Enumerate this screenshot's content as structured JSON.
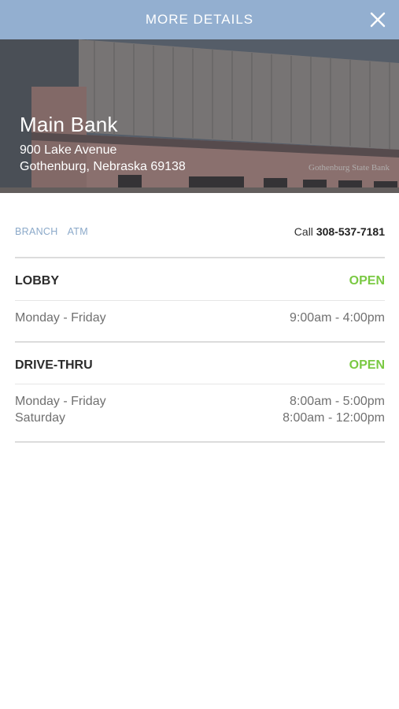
{
  "header": {
    "title": "MORE DETAILS",
    "close_icon": "close-icon"
  },
  "location": {
    "name": "Main Bank",
    "address_line1": "900 Lake Avenue",
    "address_line2": "Gothenburg, Nebraska 69138",
    "building_sign": "Gothenburg State Bank"
  },
  "tabs": [
    {
      "label": "BRANCH"
    },
    {
      "label": "ATM"
    }
  ],
  "call": {
    "prefix": "Call",
    "number": "308-537-7181"
  },
  "sections": [
    {
      "title": "LOBBY",
      "status": "OPEN",
      "hours": [
        {
          "days": "Monday - Friday",
          "time": "9:00am - 4:00pm"
        }
      ]
    },
    {
      "title": "DRIVE-THRU",
      "status": "OPEN",
      "hours": [
        {
          "days": "Monday - Friday",
          "time": "8:00am - 5:00pm"
        },
        {
          "days": "Saturday",
          "time": "8:00am - 12:00pm"
        }
      ]
    }
  ],
  "colors": {
    "header_bg": "#93afd0",
    "tab_text": "#8ba9c9",
    "open_status": "#7ac943"
  }
}
